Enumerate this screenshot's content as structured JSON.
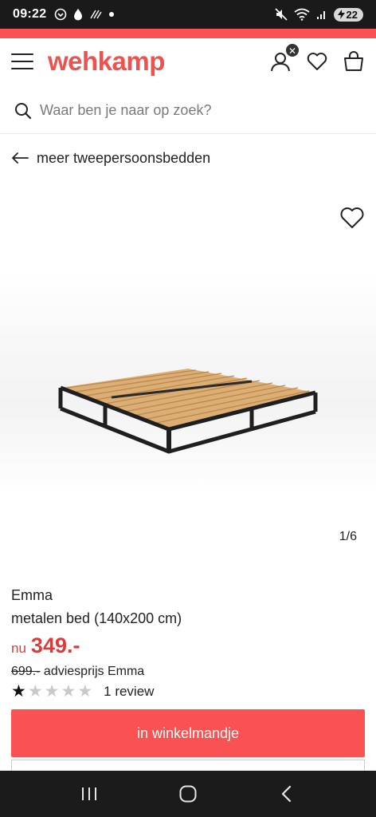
{
  "status_bar": {
    "time": "09:22",
    "battery": "22"
  },
  "header": {
    "logo": "wehkamp",
    "account_badge": "✕"
  },
  "search": {
    "placeholder": "Waar ben je naar op zoek?"
  },
  "back_link": {
    "label": "meer tweepersoonsbedden"
  },
  "gallery": {
    "counter": "1/6"
  },
  "product": {
    "brand": "Emma",
    "name": "metalen bed (140x200 cm)",
    "price_prefix": "nu",
    "price": "349.-",
    "rrp_value": "699.-",
    "rrp_label": "adviesprijs Emma",
    "rating": 1,
    "rating_max": 5,
    "review_text": "1 review"
  },
  "actions": {
    "add_to_cart": "in winkelmandje"
  },
  "colors": {
    "accent": "#fa5252",
    "price": "#e0393a",
    "logo": "#f0514f"
  }
}
